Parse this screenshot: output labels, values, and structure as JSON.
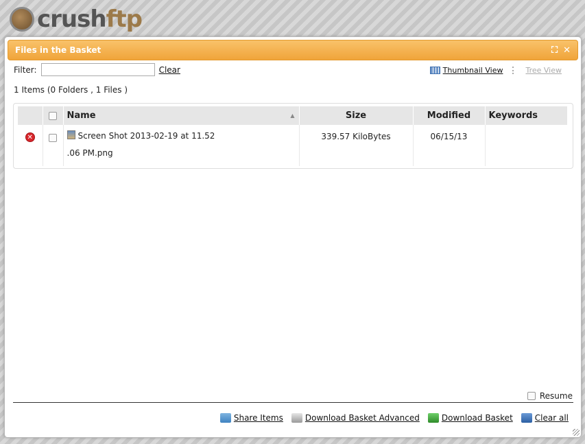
{
  "logo": {
    "part1": "crush",
    "part2": "ftp"
  },
  "dialog": {
    "title": "Files in the Basket",
    "maximize_icon": "⛶",
    "close_icon": "✕"
  },
  "filter": {
    "label": "Filter:",
    "value": "",
    "placeholder": "",
    "clear_label": "Clear"
  },
  "views": {
    "thumbnail_label": "Thumbnail View",
    "tree_label": "Tree View"
  },
  "summary": "1 Items (0 Folders , 1 Files )",
  "table": {
    "columns": {
      "name": "Name",
      "size": "Size",
      "modified": "Modified",
      "keywords": "Keywords"
    },
    "rows": [
      {
        "name_line1": "Screen Shot 2013-02-19 at 11.52",
        "name_line2": ".06 PM.png",
        "size": "339.57 KiloBytes",
        "modified": "06/15/13",
        "keywords": ""
      }
    ]
  },
  "resume_label": "Resume",
  "actions": {
    "share": "Share Items",
    "download_advanced": "Download Basket Advanced",
    "download": "Download Basket",
    "clear_all": "Clear all"
  },
  "colors": {
    "titlebar": "#f0a43a",
    "delete": "#d8262b"
  },
  "icons": [
    "maximize-icon",
    "close-icon",
    "thumbnail-view-icon",
    "tree-view-icon",
    "delete-icon",
    "image-file-icon",
    "share-icon",
    "download-advanced-icon",
    "download-icon",
    "clear-all-icon",
    "resize-grip-icon"
  ]
}
